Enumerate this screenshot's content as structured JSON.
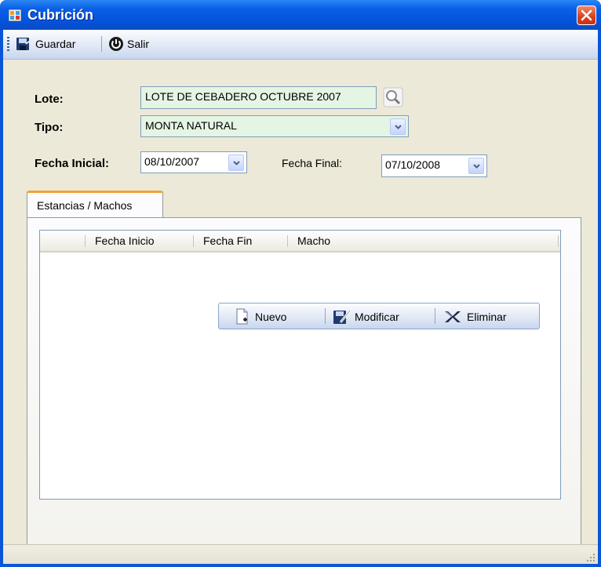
{
  "window": {
    "title": "Cubrición"
  },
  "toolbar": {
    "save_label": "Guardar",
    "exit_label": "Salir"
  },
  "form": {
    "lote_label": "Lote:",
    "lote_value": "LOTE DE CEBADERO OCTUBRE 2007",
    "tipo_label": "Tipo:",
    "tipo_value": "MONTA NATURAL",
    "fecha_inicial_label": "Fecha Inicial:",
    "fecha_inicial_value": "08/10/2007",
    "fecha_final_label": "Fecha Final:",
    "fecha_final_value": "07/10/2008"
  },
  "tabs": [
    {
      "label": "Estancias / Machos",
      "selected": true
    }
  ],
  "grid": {
    "columns": [
      "",
      "Fecha Inicio",
      "Fecha Fin",
      "Macho"
    ],
    "rows": []
  },
  "actions": {
    "new_label": "Nuevo",
    "edit_label": "Modificar",
    "delete_label": "Eliminar"
  },
  "colors": {
    "titlebar": "#0a5fe6",
    "field_bg": "#e4f5e4",
    "tab_accent": "#f0a23a",
    "close": "#d8401c"
  },
  "icons": [
    "app-icon",
    "close-icon",
    "save-icon",
    "power-icon",
    "search-lookup-icon",
    "chevron-down-icon",
    "new-document-icon",
    "edit-icon",
    "delete-icon",
    "size-grip-icon"
  ]
}
